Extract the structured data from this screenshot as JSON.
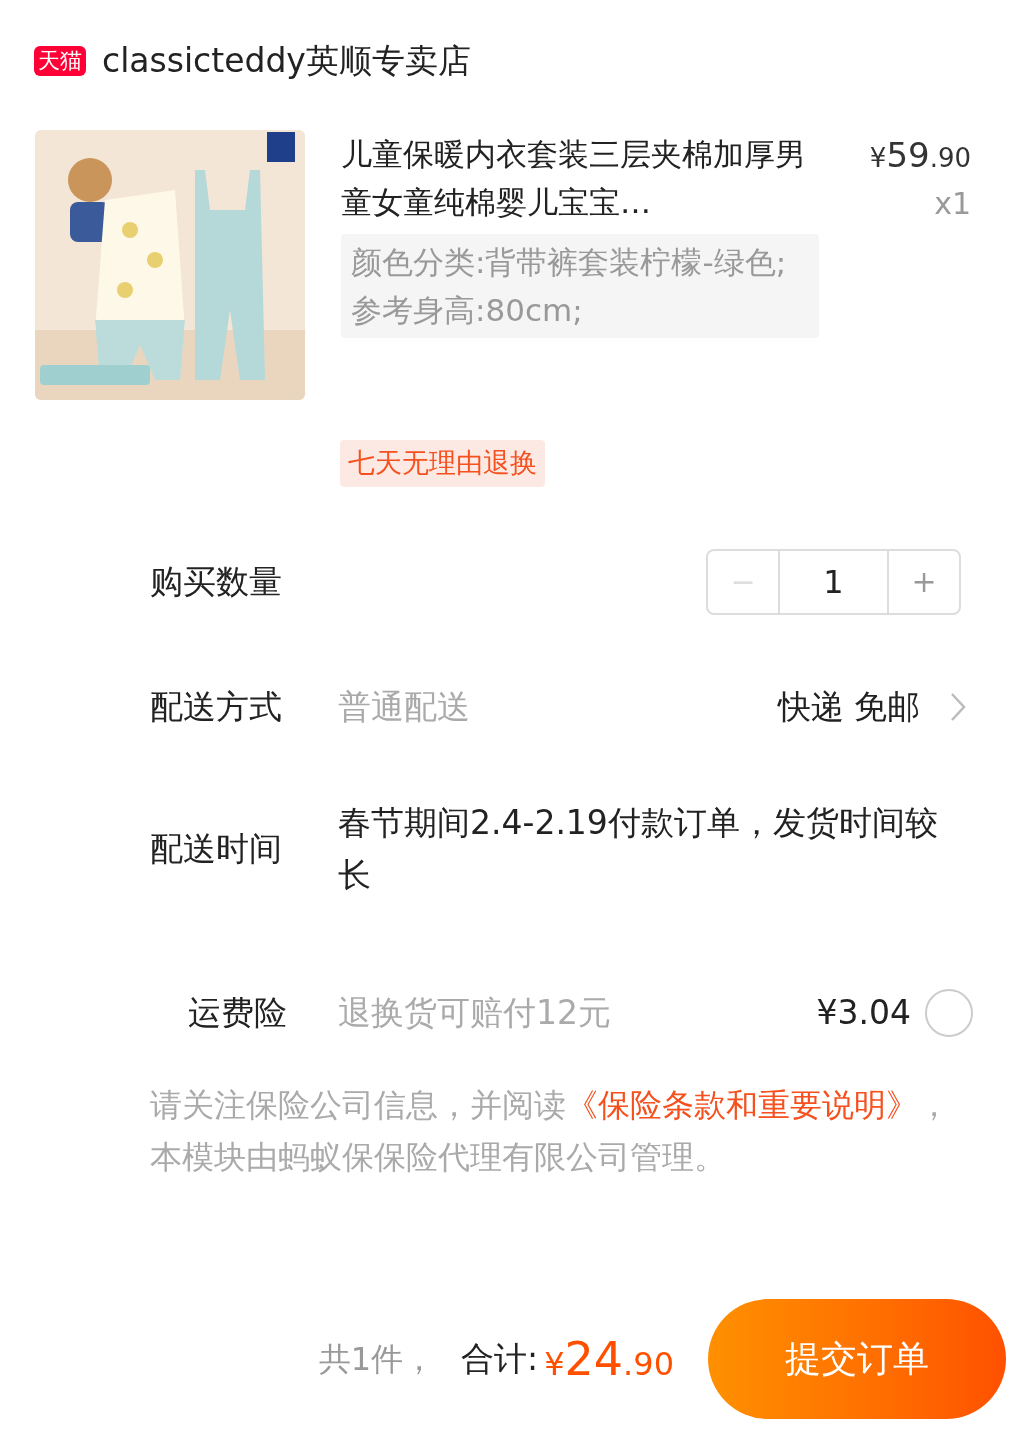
{
  "store": {
    "logo_text": "天猫",
    "name": "classicteddy英顺专卖店"
  },
  "product": {
    "title": "儿童保暖内衣套装三层夹棉加厚男童女童纯棉婴儿宝宝…",
    "price": {
      "currency": "¥",
      "integer": "59",
      "decimal": ".90"
    },
    "quantity": "x1",
    "spec": "颜色分类:背带裤套装柠檬-绿色;参考身高:80cm;",
    "badge": "七天无理由退换"
  },
  "quantity_row": {
    "label": "购买数量",
    "minus": "−",
    "value": "1",
    "plus": "+",
    "minus_disabled": true
  },
  "shipping": {
    "label": "配送方式",
    "method": "普通配送",
    "value": "快递 免邮"
  },
  "delivery_time": {
    "label": "配送时间",
    "value": "春节期间2.4-2.19付款订单，发货时间较长"
  },
  "insurance": {
    "label": "运费险",
    "description": "退换货可赔付12元",
    "price": "¥3.04",
    "selected": false
  },
  "notice": {
    "before": "请关注保险公司信息，并阅读",
    "link": "《保险条款和重要说明》",
    "after": "，本模块由蚂蚁保保险代理有限公司管理。"
  },
  "footer": {
    "count": "共1件，",
    "total_label": "合计:",
    "total": {
      "currency": "¥",
      "integer": "24",
      "decimal": ".90"
    },
    "submit": "提交订单"
  }
}
